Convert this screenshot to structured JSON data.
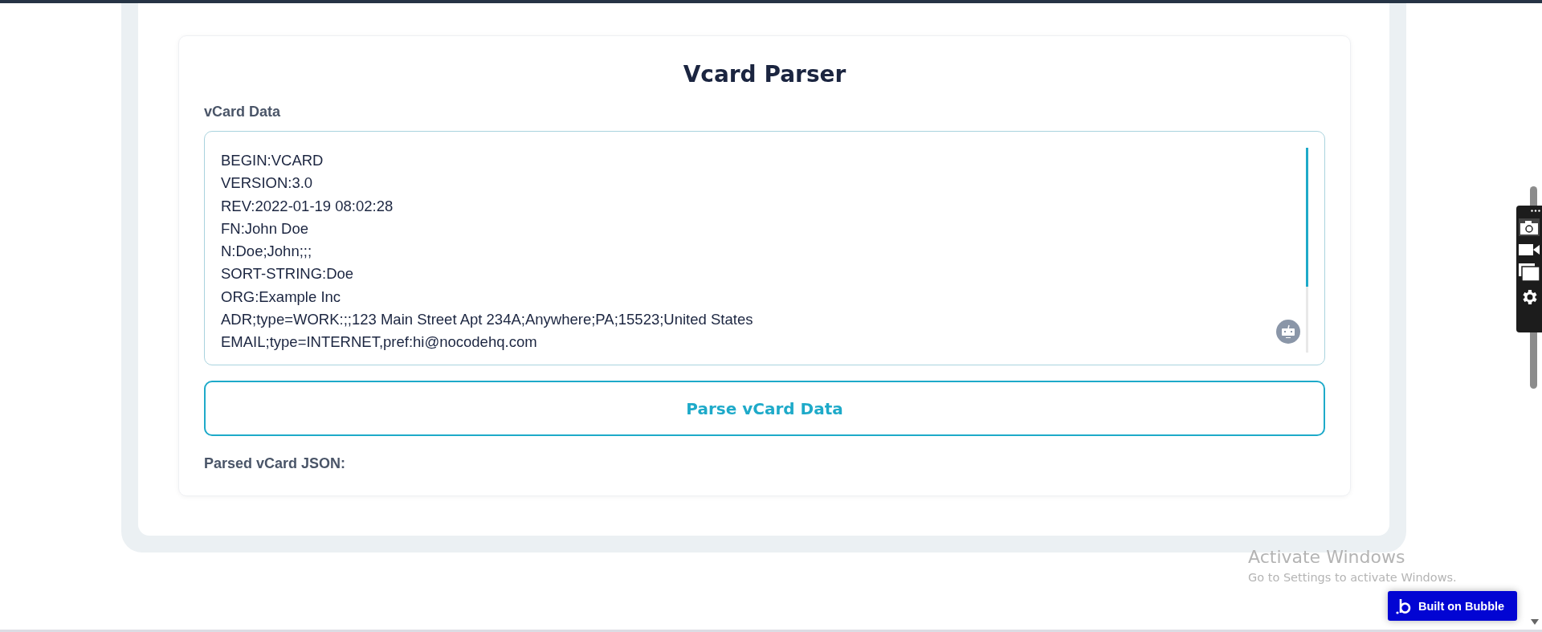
{
  "card": {
    "title": "Vcard Parser",
    "field_label": "vCard Data",
    "vcard_lines": [
      "BEGIN:VCARD",
      "VERSION:3.0",
      "REV:2022-01-19 08:02:28",
      "FN:John Doe",
      "N:Doe;John;;;",
      "SORT-STRING:Doe",
      "ORG:Example Inc",
      "ADR;type=WORK:;;123 Main Street Apt 234A;Anywhere;PA;15523;United States",
      "EMAIL;type=INTERNET,pref:hi@nocodehq.com"
    ],
    "button": "Parse vCard Data",
    "result_label": "Parsed vCard JSON:"
  },
  "os_notice": {
    "title": "Activate Windows",
    "subtitle": "Go to Settings to activate Windows."
  },
  "badge": {
    "label": "Built on Bubble"
  }
}
